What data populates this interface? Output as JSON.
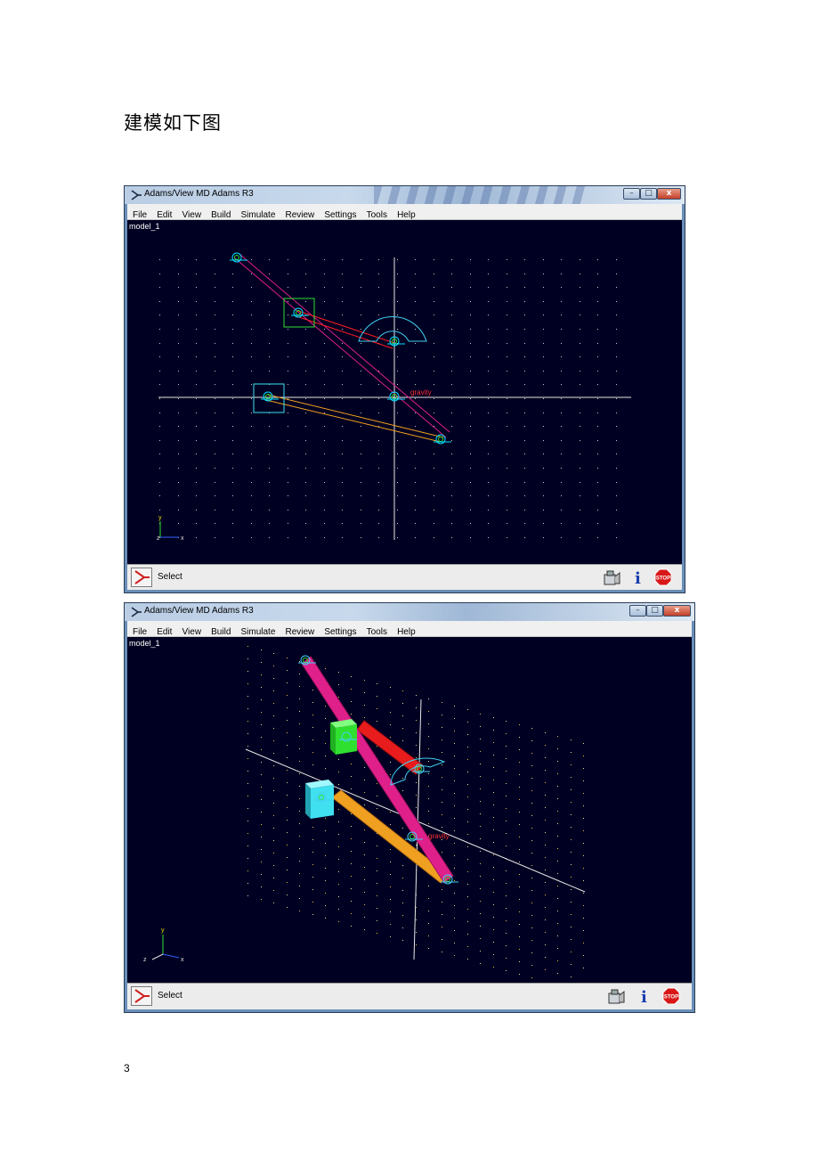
{
  "document": {
    "heading": "建模如下图",
    "page_number": "3"
  },
  "windows": [
    {
      "title": "Adams/View MD Adams R3",
      "menu": [
        "File",
        "Edit",
        "View",
        "Build",
        "Simulate",
        "Review",
        "Settings",
        "Tools",
        "Help"
      ],
      "model_name": "model_1",
      "status_text": "Select",
      "labels": {
        "gravity": "gravity",
        "axis_x": "x",
        "axis_y": "y",
        "axis_z": "z"
      },
      "colors": {
        "background": "#000022",
        "grid": "#c8c8c8",
        "link_a": "#e0208a",
        "link_b": "#ff2020",
        "link_c": "#f0a020",
        "marker": "#00e0ff"
      }
    },
    {
      "title": "Adams/View MD Adams R3",
      "menu": [
        "File",
        "Edit",
        "View",
        "Build",
        "Simulate",
        "Review",
        "Settings",
        "Tools",
        "Help"
      ],
      "model_name": "model_1",
      "status_text": "Select",
      "labels": {
        "gravity": "gravity",
        "axis_x": "x",
        "axis_y": "y",
        "axis_z": "z"
      },
      "colors": {
        "background": "#000022",
        "grid": "#d8d840",
        "link_a": "#e0208a",
        "link_b": "#e81c1c",
        "link_c": "#f0a020",
        "block_a": "#30e030",
        "block_b": "#40e0f0"
      }
    }
  ],
  "icons": {
    "app": "adams-logo-icon",
    "minimize": "minimize-icon",
    "maximize": "maximize-icon",
    "close": "close-icon",
    "status_tools": "toolbox-icon",
    "status_info": "info-icon",
    "status_stop": "stop-icon"
  },
  "glyphs": {
    "minimize": "–",
    "maximize": "□",
    "close": "x",
    "info": "i",
    "stop": "STOP"
  }
}
